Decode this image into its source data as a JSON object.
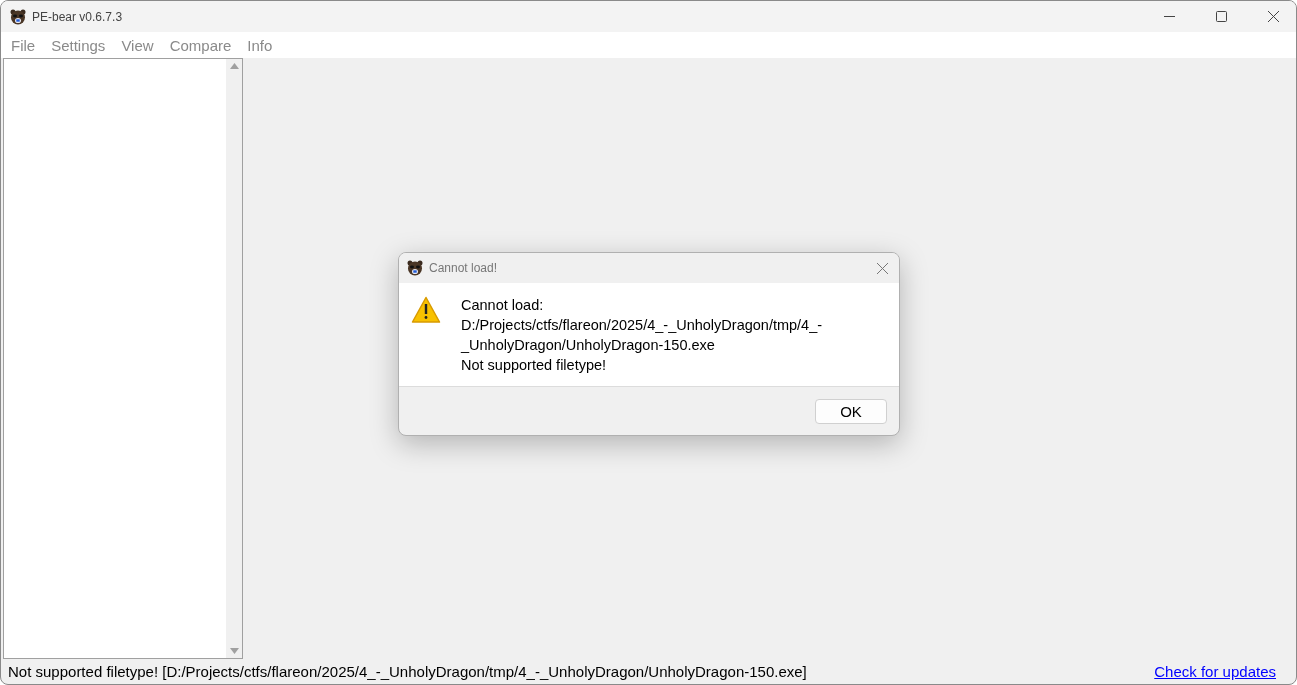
{
  "window": {
    "title": "PE-bear v0.6.7.3"
  },
  "menu": [
    "File",
    "Settings",
    "View",
    "Compare",
    "Info"
  ],
  "dialog": {
    "title": "Cannot load!",
    "message_lines": [
      "Cannot load:",
      "D:/Projects/ctfs/flareon/2025/4_-_UnholyDragon/tmp/4_-",
      "_UnholyDragon/UnholyDragon-150.exe",
      "Not supported filetype!"
    ],
    "button": "OK"
  },
  "status_bar": {
    "message": "Not supported filetype! [D:/Projects/ctfs/flareon/2025/4_-_UnholyDragon/tmp/4_-_UnholyDragon/UnholyDragon-150.exe]",
    "link": "Check for updates"
  }
}
